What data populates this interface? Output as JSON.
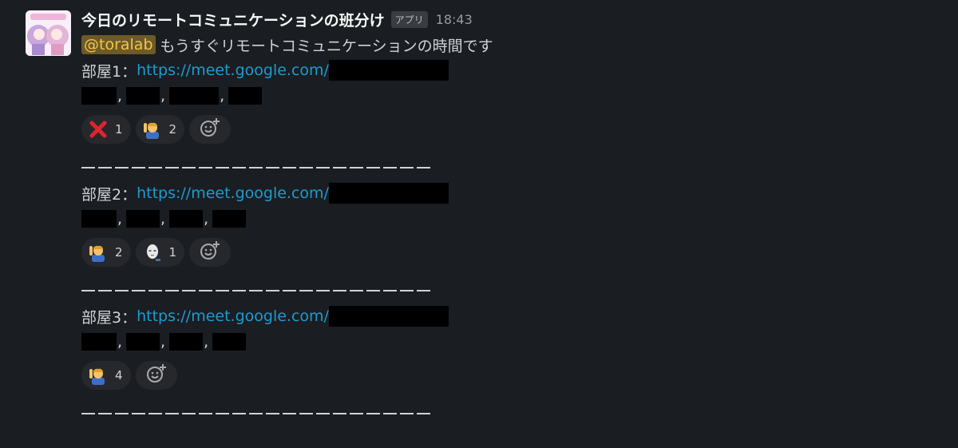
{
  "message": {
    "sender": "今日のリモートコミュニケーションの班分け",
    "app_badge": "アプリ",
    "time": "18:43",
    "mention": "@toralab",
    "intro_text": "もうすぐリモートコミュニケーションの時間です"
  },
  "rooms": [
    {
      "label": "部屋1：",
      "url": "https://meet.google.com/",
      "reactions": [
        {
          "emoji": "cross-mark",
          "count": "1"
        },
        {
          "emoji": "person-raising-hand",
          "count": "2"
        }
      ]
    },
    {
      "label": "部屋2：",
      "url": "https://meet.google.com/",
      "reactions": [
        {
          "emoji": "person-raising-hand",
          "count": "2"
        },
        {
          "emoji": "face-mask-avatar",
          "count": "1"
        }
      ]
    },
    {
      "label": "部屋3：",
      "url": "https://meet.google.com/",
      "reactions": [
        {
          "emoji": "person-raising-hand",
          "count": "4"
        }
      ]
    }
  ],
  "comma": ",",
  "colors": {
    "background": "#1a1d21",
    "link": "#1d9bd1",
    "mention_bg": "#6e5a29",
    "mention_text": "#f2c744"
  }
}
